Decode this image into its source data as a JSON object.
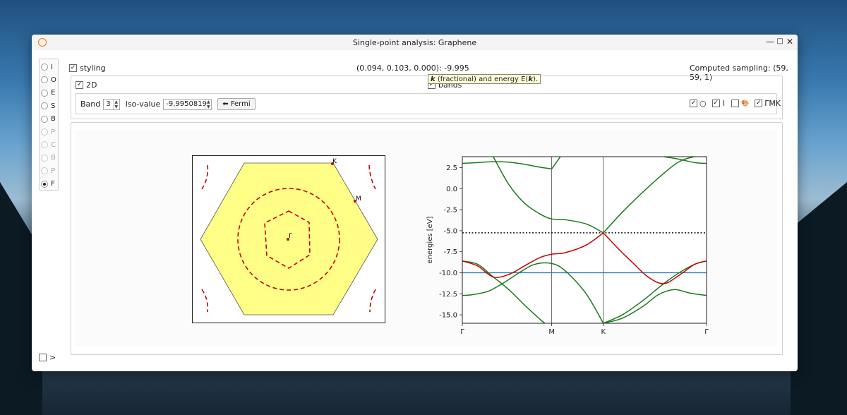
{
  "window": {
    "title": "Single-point analysis: Graphene",
    "controls": {
      "minimize": "—",
      "maximize": "□",
      "close": "✕"
    }
  },
  "sidebar": {
    "items": [
      {
        "label": "I",
        "checked": false,
        "enabled": true
      },
      {
        "label": "O",
        "checked": false,
        "enabled": true
      },
      {
        "label": "E",
        "checked": false,
        "enabled": true
      },
      {
        "label": "S",
        "checked": false,
        "enabled": true
      },
      {
        "label": "B",
        "checked": false,
        "enabled": true
      },
      {
        "label": "P",
        "checked": false,
        "enabled": false
      },
      {
        "label": "C",
        "checked": false,
        "enabled": false
      },
      {
        "label": "B",
        "checked": false,
        "enabled": false
      },
      {
        "label": "P",
        "checked": false,
        "enabled": false
      },
      {
        "label": "F",
        "checked": true,
        "enabled": true
      }
    ],
    "bottom_toggle": ">"
  },
  "top": {
    "styling_label": "styling",
    "coords": "(0.094, 0.103, 0.000): -9.995",
    "sampling": "Computed sampling:  (59, 59, 1)"
  },
  "tooltip": {
    "k": "k",
    "mid": " (fractional) and energy E(",
    "k2": "k",
    "end": ")."
  },
  "options": {
    "twod_label": "2D",
    "bands_label": "bands",
    "band_label": "Band",
    "band_value": "3",
    "iso_label": "Iso-value",
    "iso_value": "-9,9950819",
    "fermi_button": "⬅ Fermi",
    "toggles": {
      "circle": "○",
      "curve": "⌇",
      "palette": "🎨",
      "path": "ΓMK"
    }
  },
  "bz_plot": {
    "labels": {
      "K": "K",
      "M": "M",
      "Gamma": "Γ"
    },
    "fill_color": "#ffff88",
    "contour_color": "#cc0000"
  },
  "chart_data": {
    "type": "line",
    "ylabel": "energies [eV]",
    "xlabel": "",
    "x_ticks": [
      "Γ",
      "M",
      "K",
      "Γ"
    ],
    "x_tick_positions": [
      0,
      0.866,
      1.366,
      2.366
    ],
    "xlim": [
      0,
      2.366
    ],
    "ylim": [
      -16,
      3.8
    ],
    "y_ticks": [
      "2.5",
      "0.0",
      "-2.5",
      "-5.0",
      "-7.5",
      "-10.0",
      "-12.5",
      "-15.0"
    ],
    "y_tick_values": [
      2.5,
      0,
      -2.5,
      -5,
      -7.5,
      -10,
      -12.5,
      -15
    ],
    "fermi_level": -5.25,
    "iso_level": -9.995,
    "series": [
      {
        "color": "#1a7a1a",
        "x": [
          0,
          0.15,
          0.3,
          0.45,
          0.6,
          0.75,
          0.866
        ],
        "y": [
          3.0,
          3.1,
          3.2,
          3.15,
          2.9,
          2.55,
          2.35
        ]
      },
      {
        "color": "#1a7a1a",
        "x": [
          0.866,
          0.95
        ],
        "y": [
          2.35,
          3.8
        ]
      },
      {
        "color": "#1a7a1a",
        "x": [
          0.3,
          0.45,
          0.6,
          0.75,
          0.866,
          1.0,
          1.2,
          1.366
        ],
        "y": [
          3.8,
          0.5,
          -1.7,
          -3.0,
          -3.6,
          -3.7,
          -4.2,
          -5.25
        ]
      },
      {
        "color": "#1a7a1a",
        "x": [
          0,
          0.1,
          0.25,
          0.4,
          0.55,
          0.7,
          0.866,
          1.0,
          1.2,
          1.366
        ],
        "y": [
          -12.7,
          -12.6,
          -12.2,
          -11.2,
          -10.0,
          -9.0,
          -8.9,
          -9.8,
          -12.5,
          -16.0
        ]
      },
      {
        "color": "#1a7a1a",
        "x": [
          0,
          0.15,
          0.3,
          0.45,
          0.6,
          0.75,
          0.8
        ],
        "y": [
          -8.6,
          -9.0,
          -10.5,
          -12.0,
          -13.8,
          -15.5,
          -16.0
        ]
      },
      {
        "color": "#cc0000",
        "x": [
          0,
          0.15,
          0.3,
          0.45,
          0.6,
          0.75,
          0.866,
          1.0,
          1.2,
          1.366
        ],
        "y": [
          -8.6,
          -9.2,
          -10.5,
          -10.2,
          -9.2,
          -8.2,
          -7.8,
          -7.6,
          -6.7,
          -5.25
        ]
      },
      {
        "color": "#1a7a1a",
        "x": [
          1.366,
          1.55,
          1.75,
          1.95,
          2.1,
          2.25,
          2.366
        ],
        "y": [
          -5.25,
          -2.8,
          -0.4,
          1.8,
          3.2,
          3.8,
          3.8
        ]
      },
      {
        "color": "#1a7a1a",
        "x": [
          1.95,
          2.1,
          2.25,
          2.366
        ],
        "y": [
          3.8,
          3.5,
          3.1,
          3.0
        ]
      },
      {
        "color": "#1a7a1a",
        "x": [
          1.366,
          1.55,
          1.75,
          1.95,
          2.1,
          2.25,
          2.366
        ],
        "y": [
          -16.0,
          -15.0,
          -13.3,
          -11.3,
          -10.0,
          -9.0,
          -8.6
        ]
      },
      {
        "color": "#1a7a1a",
        "x": [
          1.366,
          1.55,
          1.75,
          1.9,
          2.05,
          2.2,
          2.366
        ],
        "y": [
          -16.0,
          -15.4,
          -14.0,
          -12.6,
          -12.0,
          -12.4,
          -12.7
        ]
      },
      {
        "color": "#cc0000",
        "x": [
          1.366,
          1.5,
          1.65,
          1.8,
          1.95,
          2.1,
          2.25,
          2.366
        ],
        "y": [
          -5.25,
          -7.0,
          -8.8,
          -10.5,
          -11.3,
          -10.3,
          -9.0,
          -8.6
        ]
      }
    ]
  }
}
